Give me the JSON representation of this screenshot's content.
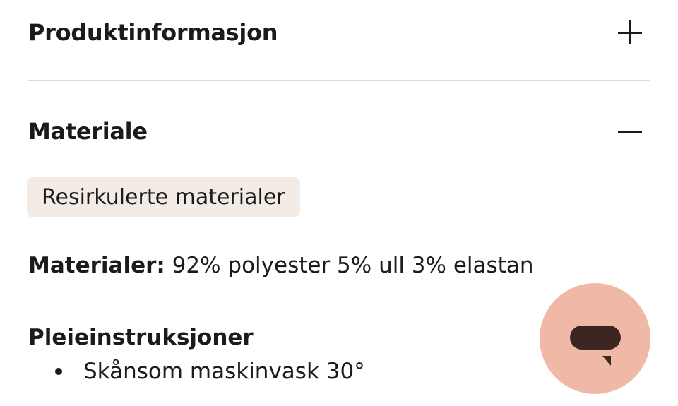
{
  "accordion": {
    "product_info": {
      "title": "Produktinformasjon",
      "state": "collapsed",
      "icon": "plus-icon"
    },
    "material": {
      "title": "Materiale",
      "state": "expanded",
      "icon": "minus-icon",
      "tag": "Resirkulerte materialer",
      "materials_label": "Materialer:",
      "materials_value": " 92% polyester 5% ull 3% elastan",
      "care_title": "Pleieinstruksjoner",
      "care_items": [
        "Skånsom maskinvask 30°"
      ]
    }
  },
  "chat": {
    "icon": "chat-bubble-icon",
    "button_color": "#f0b8a6",
    "icon_color": "#3d2622"
  },
  "colors": {
    "text": "#1c1b19",
    "divider": "#dedad6",
    "tag_background": "#f3ece6"
  }
}
